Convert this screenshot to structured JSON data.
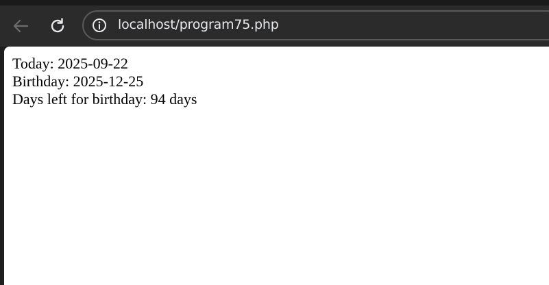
{
  "browser": {
    "url": "localhost/program75.php",
    "icons": {
      "back": "arrow-left-icon",
      "reload": "reload-icon",
      "info": "info-circle-icon"
    },
    "colors": {
      "chrome_bg": "#2b2b2b",
      "omnibox_border": "#5a5a5a",
      "url_text": "#e8eaed",
      "icon_active": "#e8eaed",
      "icon_disabled": "#6d6d6d"
    }
  },
  "page": {
    "lines": [
      "Today: 2025-09-22",
      "Birthday: 2025-12-25",
      "Days left for birthday: 94 days"
    ]
  }
}
